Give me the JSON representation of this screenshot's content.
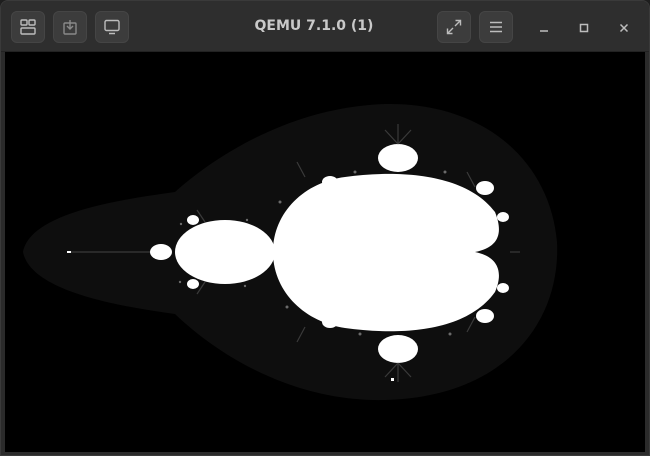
{
  "window": {
    "title": "QEMU 7.1.0 (1)"
  },
  "header": {
    "left_buttons": [
      {
        "name": "tabs-overview-button",
        "icon": "tabs-icon"
      },
      {
        "name": "usb-devices-button",
        "icon": "usb-icon"
      },
      {
        "name": "display-button",
        "icon": "monitor-icon"
      }
    ],
    "right_buttons": [
      {
        "name": "fullscreen-button",
        "icon": "expand-icon"
      },
      {
        "name": "menu-button",
        "icon": "hamburger-icon"
      }
    ],
    "window_controls": [
      "minimize-icon",
      "maximize-icon",
      "close-icon"
    ]
  },
  "colors": {
    "titlebar": "#2e2e2e",
    "button": "#3c3c3c",
    "icon": "#bdbdbd",
    "display_bg": "#000000",
    "fractal_halo": "#0e0e0e",
    "fractal_set": "#ffffff"
  },
  "display": {
    "content": "mandelbrot-fractal"
  }
}
